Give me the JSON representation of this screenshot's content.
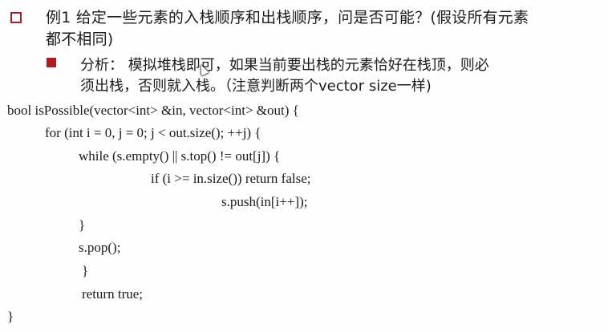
{
  "slide": {
    "heading_line1": "例1 给定一些元素的入栈顺序和出栈顺序，问是否可能？(假设所有元素",
    "heading_line2": "都不相同)",
    "analysis_line1": "分析：  模拟堆栈即可，如果当前要出栈的元素恰好在栈顶，则必",
    "analysis_line2": "须出栈，否则就入栈。（注意判断两个vector size一样)"
  },
  "code": {
    "lines": [
      "bool isPossible(vector<int> &in, vector<int> &out) {",
      "for (int i = 0, j = 0; j < out.size(); ++j) {",
      "while (s.empty() || s.top() != out[j]) {",
      "if (i >= in.size()) return false;",
      "s.push(in[i++]);",
      "}",
      "s.pop();",
      "}",
      "return true;",
      "}"
    ]
  },
  "colors": {
    "bullet": "#b01c24",
    "text": "#1c1c1c",
    "background": "#fefefe"
  },
  "icons": {
    "cursor": "mouse-pointer-icon"
  }
}
